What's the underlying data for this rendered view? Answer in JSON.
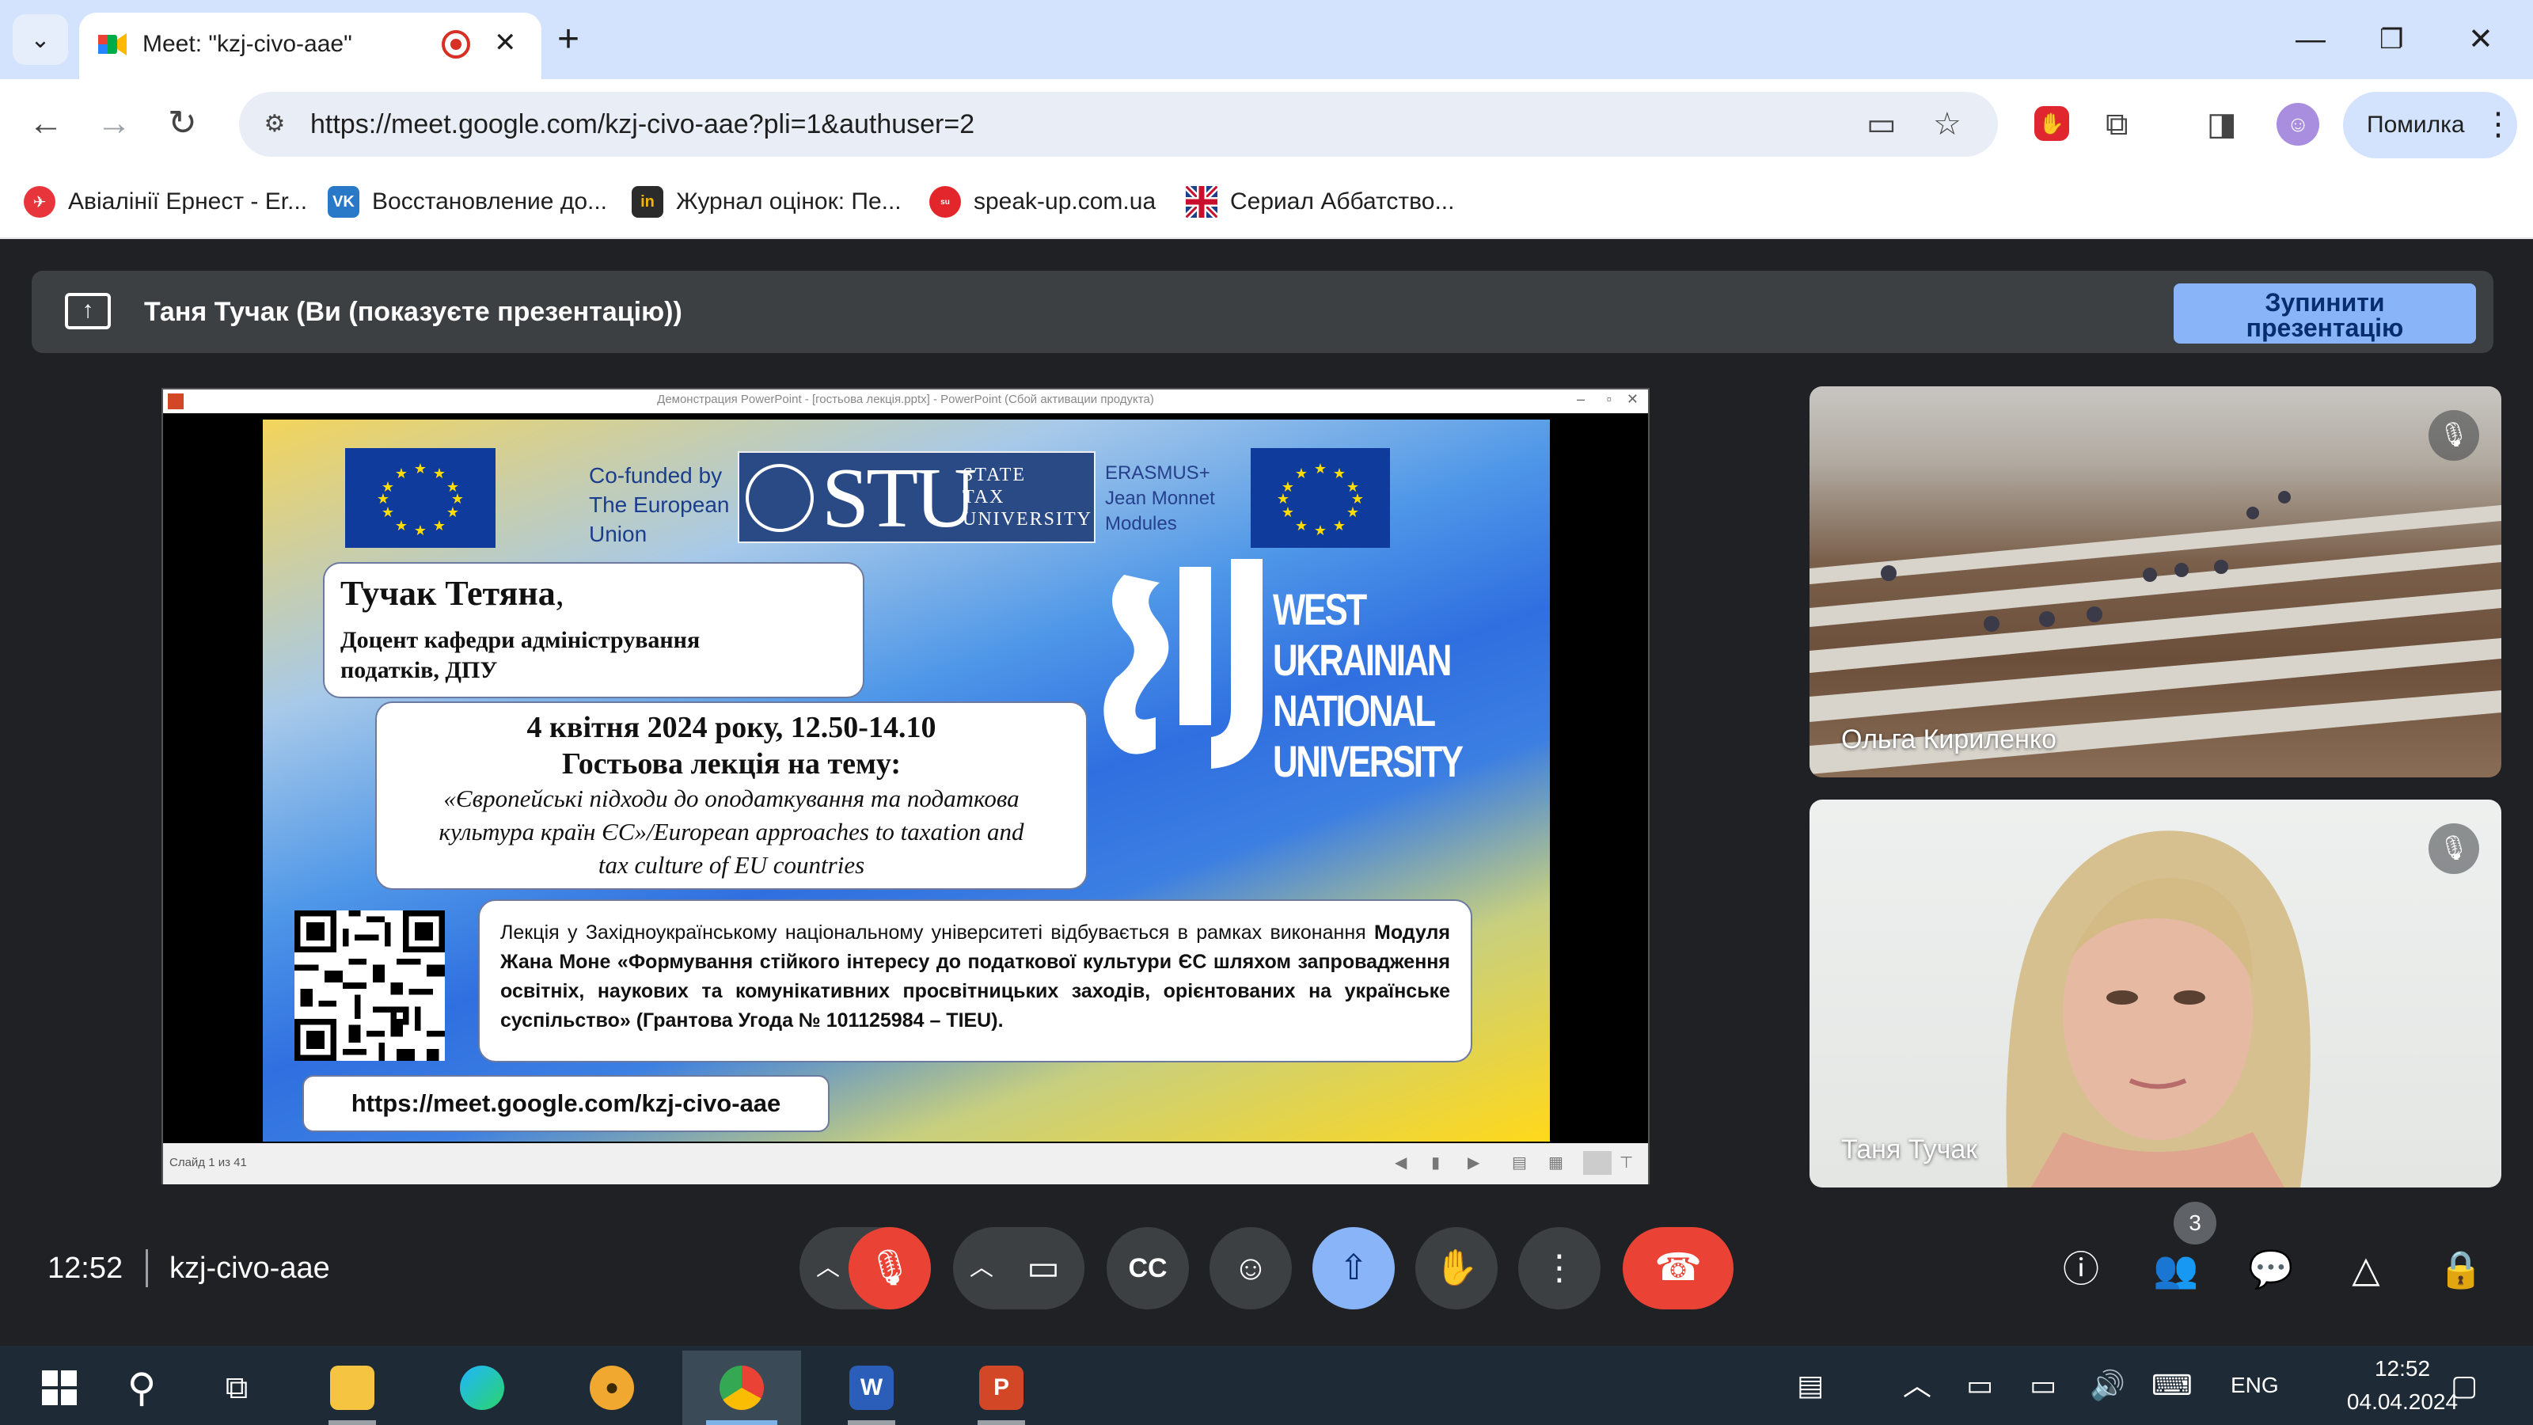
{
  "browser": {
    "tab_title": "Meet: \"kzj-civo-aae\"",
    "url": "https://meet.google.com/kzj-civo-aae?pli=1&authuser=2",
    "profile_error": "Помилка",
    "bookmarks": [
      {
        "label": "Авіалінії Ернест - Er...",
        "color": "#e8353b"
      },
      {
        "label": "Восстановление до...",
        "color": "#2a78c8"
      },
      {
        "label": "Журнал оцінок: Пе...",
        "color": "#2b2b2b"
      },
      {
        "label": "speak-up.com.ua",
        "color": "#e3262c"
      },
      {
        "label": "Сериал Аббатство...",
        "color": "#1d3f8f"
      }
    ]
  },
  "meet": {
    "presenter_text": "Таня Тучак (Ви (показуєте презентацію))",
    "stop_label_line1": "Зупинити",
    "stop_label_line2": "презентацію",
    "clock": "12:52",
    "meeting_code": "kzj-civo-aae",
    "people_count": "3",
    "participants": [
      {
        "name": "Ольга Кириленко",
        "muted": true
      },
      {
        "name": "Таня Тучак",
        "muted": true
      }
    ]
  },
  "ppt": {
    "window_title": "Демонстрация PowerPoint - [гостьова лекція.pptx] - PowerPoint (Сбой активации продукта)",
    "slide_counter": "Слайд 1 из 41"
  },
  "slide": {
    "cofunded": [
      "Co-funded by",
      "The European",
      "Union"
    ],
    "stu_big": "STU",
    "stu_sub": [
      "STATE",
      "TAX",
      "UNIVERSITY"
    ],
    "erasmus": [
      "ERASMUS+",
      "Jean Monnet",
      "Modules"
    ],
    "wunu": [
      "WEST UKRAINIAN",
      "NATIONAL",
      "UNIVERSITY"
    ],
    "card1_name": "Тучак Тетяна",
    "card1_name_suffix": ",",
    "card1_position_l1": "Доцент кафедри адміністрування",
    "card1_position_l2": "податків, ДПУ",
    "card2_date": "4 квітня 2024 року, 12.50-14.10",
    "card2_topic": "Гостьова лекція на тему:",
    "card2_desc_l1": "«Європейські підходи до оподаткування та податкова",
    "card2_desc_l2": "культура країн ЄС»/European approaches to taxation and",
    "card2_desc_l3": "tax culture of EU countries",
    "card3_plain": "Лекція у Західноукраїнському національному університеті відбувається в рамках виконання",
    "card3_bold": "Модуля Жана Моне «Формування стійкого інтересу до податкової культури ЄС шляхом запровадження освітніх, наукових та комунікативних просвітницьких заходів, орієнтованих на українське суспільство» (Грантова Угода №  101125984 – TIEU).",
    "link": "https://meet.google.com/kzj-civo-aae"
  },
  "taskbar": {
    "lang": "ENG",
    "time": "12:52",
    "date": "04.04.2024"
  }
}
